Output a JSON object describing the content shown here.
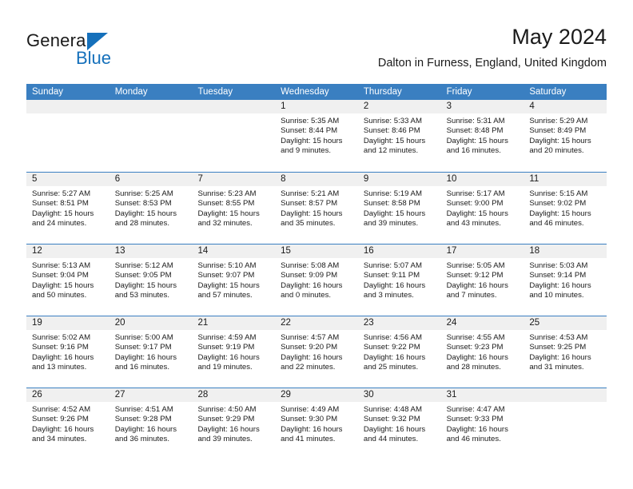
{
  "brand": {
    "name_top": "General",
    "name_bottom": "Blue",
    "triangle_color": "#1570bb"
  },
  "header": {
    "month_title": "May 2024",
    "location": "Dalton in Furness, England, United Kingdom"
  },
  "theme": {
    "header_blue": "#3a7fc1",
    "day_band_gray": "#f0f0f0",
    "text_color": "#1a1a1a"
  },
  "calendar": {
    "weekdays": [
      "Sunday",
      "Monday",
      "Tuesday",
      "Wednesday",
      "Thursday",
      "Friday",
      "Saturday"
    ],
    "weeks": [
      [
        {
          "day": "",
          "sunrise": "",
          "sunset": "",
          "daylight": ""
        },
        {
          "day": "",
          "sunrise": "",
          "sunset": "",
          "daylight": ""
        },
        {
          "day": "",
          "sunrise": "",
          "sunset": "",
          "daylight": ""
        },
        {
          "day": "1",
          "sunrise": "Sunrise: 5:35 AM",
          "sunset": "Sunset: 8:44 PM",
          "daylight": "Daylight: 15 hours and 9 minutes."
        },
        {
          "day": "2",
          "sunrise": "Sunrise: 5:33 AM",
          "sunset": "Sunset: 8:46 PM",
          "daylight": "Daylight: 15 hours and 12 minutes."
        },
        {
          "day": "3",
          "sunrise": "Sunrise: 5:31 AM",
          "sunset": "Sunset: 8:48 PM",
          "daylight": "Daylight: 15 hours and 16 minutes."
        },
        {
          "day": "4",
          "sunrise": "Sunrise: 5:29 AM",
          "sunset": "Sunset: 8:49 PM",
          "daylight": "Daylight: 15 hours and 20 minutes."
        }
      ],
      [
        {
          "day": "5",
          "sunrise": "Sunrise: 5:27 AM",
          "sunset": "Sunset: 8:51 PM",
          "daylight": "Daylight: 15 hours and 24 minutes."
        },
        {
          "day": "6",
          "sunrise": "Sunrise: 5:25 AM",
          "sunset": "Sunset: 8:53 PM",
          "daylight": "Daylight: 15 hours and 28 minutes."
        },
        {
          "day": "7",
          "sunrise": "Sunrise: 5:23 AM",
          "sunset": "Sunset: 8:55 PM",
          "daylight": "Daylight: 15 hours and 32 minutes."
        },
        {
          "day": "8",
          "sunrise": "Sunrise: 5:21 AM",
          "sunset": "Sunset: 8:57 PM",
          "daylight": "Daylight: 15 hours and 35 minutes."
        },
        {
          "day": "9",
          "sunrise": "Sunrise: 5:19 AM",
          "sunset": "Sunset: 8:58 PM",
          "daylight": "Daylight: 15 hours and 39 minutes."
        },
        {
          "day": "10",
          "sunrise": "Sunrise: 5:17 AM",
          "sunset": "Sunset: 9:00 PM",
          "daylight": "Daylight: 15 hours and 43 minutes."
        },
        {
          "day": "11",
          "sunrise": "Sunrise: 5:15 AM",
          "sunset": "Sunset: 9:02 PM",
          "daylight": "Daylight: 15 hours and 46 minutes."
        }
      ],
      [
        {
          "day": "12",
          "sunrise": "Sunrise: 5:13 AM",
          "sunset": "Sunset: 9:04 PM",
          "daylight": "Daylight: 15 hours and 50 minutes."
        },
        {
          "day": "13",
          "sunrise": "Sunrise: 5:12 AM",
          "sunset": "Sunset: 9:05 PM",
          "daylight": "Daylight: 15 hours and 53 minutes."
        },
        {
          "day": "14",
          "sunrise": "Sunrise: 5:10 AM",
          "sunset": "Sunset: 9:07 PM",
          "daylight": "Daylight: 15 hours and 57 minutes."
        },
        {
          "day": "15",
          "sunrise": "Sunrise: 5:08 AM",
          "sunset": "Sunset: 9:09 PM",
          "daylight": "Daylight: 16 hours and 0 minutes."
        },
        {
          "day": "16",
          "sunrise": "Sunrise: 5:07 AM",
          "sunset": "Sunset: 9:11 PM",
          "daylight": "Daylight: 16 hours and 3 minutes."
        },
        {
          "day": "17",
          "sunrise": "Sunrise: 5:05 AM",
          "sunset": "Sunset: 9:12 PM",
          "daylight": "Daylight: 16 hours and 7 minutes."
        },
        {
          "day": "18",
          "sunrise": "Sunrise: 5:03 AM",
          "sunset": "Sunset: 9:14 PM",
          "daylight": "Daylight: 16 hours and 10 minutes."
        }
      ],
      [
        {
          "day": "19",
          "sunrise": "Sunrise: 5:02 AM",
          "sunset": "Sunset: 9:16 PM",
          "daylight": "Daylight: 16 hours and 13 minutes."
        },
        {
          "day": "20",
          "sunrise": "Sunrise: 5:00 AM",
          "sunset": "Sunset: 9:17 PM",
          "daylight": "Daylight: 16 hours and 16 minutes."
        },
        {
          "day": "21",
          "sunrise": "Sunrise: 4:59 AM",
          "sunset": "Sunset: 9:19 PM",
          "daylight": "Daylight: 16 hours and 19 minutes."
        },
        {
          "day": "22",
          "sunrise": "Sunrise: 4:57 AM",
          "sunset": "Sunset: 9:20 PM",
          "daylight": "Daylight: 16 hours and 22 minutes."
        },
        {
          "day": "23",
          "sunrise": "Sunrise: 4:56 AM",
          "sunset": "Sunset: 9:22 PM",
          "daylight": "Daylight: 16 hours and 25 minutes."
        },
        {
          "day": "24",
          "sunrise": "Sunrise: 4:55 AM",
          "sunset": "Sunset: 9:23 PM",
          "daylight": "Daylight: 16 hours and 28 minutes."
        },
        {
          "day": "25",
          "sunrise": "Sunrise: 4:53 AM",
          "sunset": "Sunset: 9:25 PM",
          "daylight": "Daylight: 16 hours and 31 minutes."
        }
      ],
      [
        {
          "day": "26",
          "sunrise": "Sunrise: 4:52 AM",
          "sunset": "Sunset: 9:26 PM",
          "daylight": "Daylight: 16 hours and 34 minutes."
        },
        {
          "day": "27",
          "sunrise": "Sunrise: 4:51 AM",
          "sunset": "Sunset: 9:28 PM",
          "daylight": "Daylight: 16 hours and 36 minutes."
        },
        {
          "day": "28",
          "sunrise": "Sunrise: 4:50 AM",
          "sunset": "Sunset: 9:29 PM",
          "daylight": "Daylight: 16 hours and 39 minutes."
        },
        {
          "day": "29",
          "sunrise": "Sunrise: 4:49 AM",
          "sunset": "Sunset: 9:30 PM",
          "daylight": "Daylight: 16 hours and 41 minutes."
        },
        {
          "day": "30",
          "sunrise": "Sunrise: 4:48 AM",
          "sunset": "Sunset: 9:32 PM",
          "daylight": "Daylight: 16 hours and 44 minutes."
        },
        {
          "day": "31",
          "sunrise": "Sunrise: 4:47 AM",
          "sunset": "Sunset: 9:33 PM",
          "daylight": "Daylight: 16 hours and 46 minutes."
        },
        {
          "day": "",
          "sunrise": "",
          "sunset": "",
          "daylight": ""
        }
      ]
    ]
  }
}
